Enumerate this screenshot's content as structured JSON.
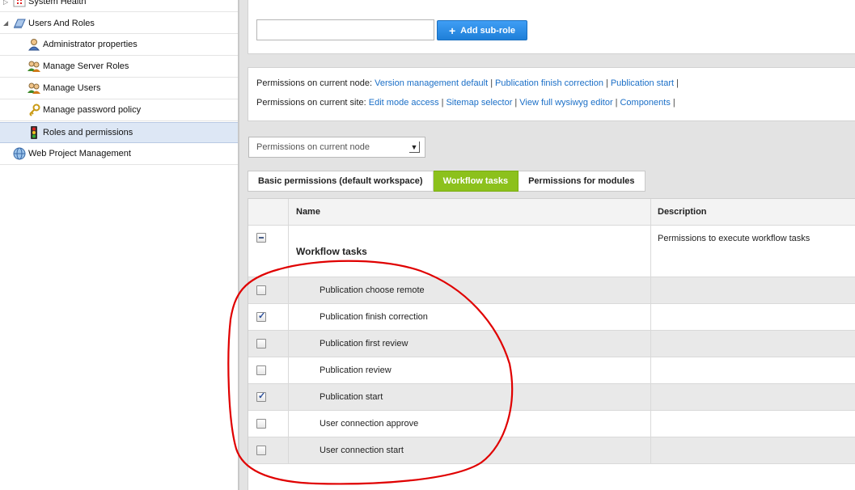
{
  "sidebar": {
    "items": [
      {
        "label": "System Health",
        "icon": "system-health-icon",
        "toggle": "▷"
      },
      {
        "label": "Users And Roles",
        "icon": "users-and-roles-icon",
        "toggle": "◢"
      },
      {
        "label": "Administrator properties",
        "icon": "administrator-icon"
      },
      {
        "label": "Manage Server Roles",
        "icon": "server-roles-icon"
      },
      {
        "label": "Manage Users",
        "icon": "users-icon"
      },
      {
        "label": "Manage password policy",
        "icon": "key-icon"
      },
      {
        "label": "Roles and permissions",
        "icon": "traffic-light-icon",
        "selected": true
      },
      {
        "label": "Web Project Management",
        "icon": "globe-icon"
      }
    ]
  },
  "toolbar": {
    "role_input_value": "",
    "add_button_label": "Add sub-role",
    "add_button_icon": "plus-icon"
  },
  "permissions_summary": {
    "node": {
      "label": "Permissions on current node:",
      "links": [
        "Version management default",
        "Publication finish correction",
        "Publication start"
      ]
    },
    "site": {
      "label": "Permissions on current site:",
      "links": [
        "Edit mode access",
        "Sitemap selector",
        "View full wysiwyg editor",
        "Components"
      ]
    },
    "separator": "|"
  },
  "scope_select": {
    "selected": "Permissions on current node",
    "arrow_icon": "dropdown-arrow-icon"
  },
  "tabs": [
    {
      "label": "Basic permissions (default workspace)",
      "active": false
    },
    {
      "label": "Workflow tasks",
      "active": true
    },
    {
      "label": "Permissions for modules",
      "active": false
    }
  ],
  "grid": {
    "headers": {
      "name": "Name",
      "description": "Description"
    },
    "group": {
      "name": "Workflow tasks",
      "description": "Permissions to execute workflow tasks",
      "state": "partial"
    },
    "rows": [
      {
        "name": "Publication choose remote",
        "checked": false
      },
      {
        "name": "Publication finish correction",
        "checked": true
      },
      {
        "name": "Publication first review",
        "checked": false
      },
      {
        "name": "Publication review",
        "checked": false
      },
      {
        "name": "Publication start",
        "checked": true
      },
      {
        "name": "User connection approve",
        "checked": false
      },
      {
        "name": "User connection start",
        "checked": false
      }
    ]
  },
  "colors": {
    "accent_button": "#2a8ae6",
    "active_tab": "#8cc11c",
    "link": "#1b6fc7",
    "annotation": "#e00000"
  }
}
